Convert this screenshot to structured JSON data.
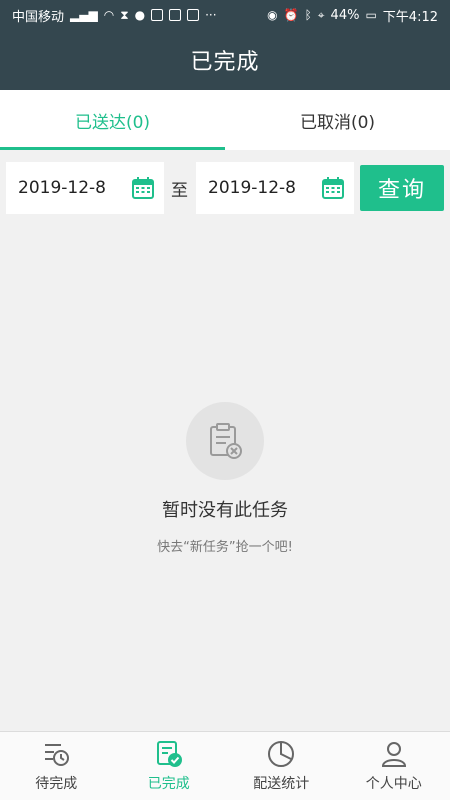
{
  "status_bar": {
    "carrier": "中国移动",
    "battery": "44%",
    "time": "下午4:12",
    "icons": [
      "signal-icon",
      "wifi-icon",
      "hourglass-icon",
      "wechat-icon",
      "shield-app-icon",
      "green-app-icon",
      "tiktok-icon",
      "more-icon",
      "eye-icon",
      "alarm-icon",
      "bluetooth-icon",
      "location-icon",
      "battery-icon"
    ]
  },
  "header": {
    "title": "已完成"
  },
  "tabs": [
    {
      "label": "已送达(0)",
      "active": true
    },
    {
      "label": "已取消(0)",
      "active": false
    }
  ],
  "filter": {
    "start_date": "2019-12-8",
    "separator": "至",
    "end_date": "2019-12-8",
    "query_label": "查询"
  },
  "empty_state": {
    "title": "暂时没有此任务",
    "subtitle": "快去“新任务”抢一个吧!"
  },
  "bottom_nav": [
    {
      "label": "待完成",
      "icon": "pending-list-icon",
      "active": false
    },
    {
      "label": "已完成",
      "icon": "completed-list-icon",
      "active": true
    },
    {
      "label": "配送统计",
      "icon": "pie-chart-icon",
      "active": false
    },
    {
      "label": "个人中心",
      "icon": "user-icon",
      "active": false
    }
  ],
  "colors": {
    "accent": "#1fbf8c",
    "header": "#34474f",
    "background": "#f1f1f1"
  }
}
